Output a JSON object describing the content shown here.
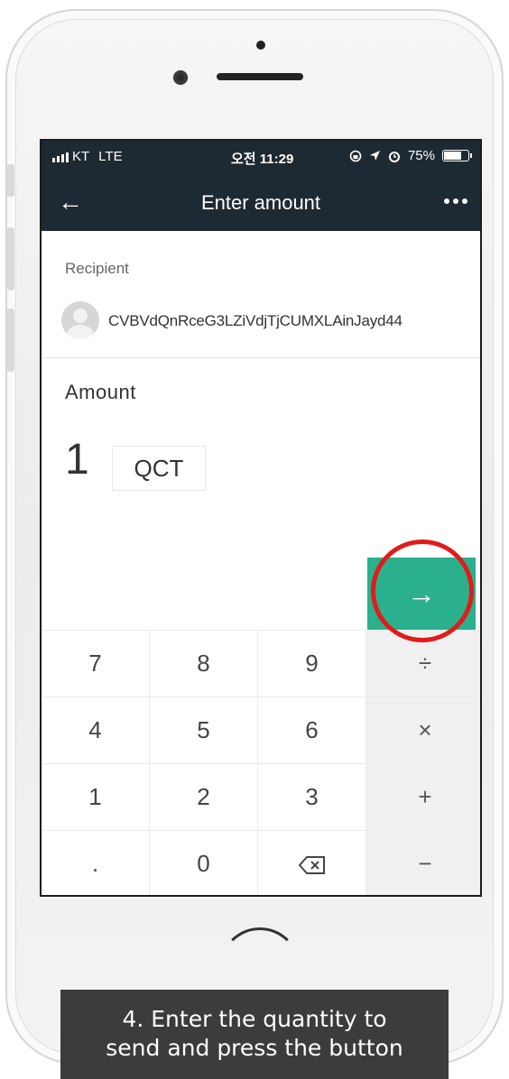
{
  "status_bar": {
    "carrier": "KT",
    "network": "LTE",
    "time": "오전 11:29",
    "status_icons": [
      "rotation-lock-icon",
      "location-icon",
      "alarm-icon"
    ],
    "battery_percent": "75%",
    "battery_level": 0.75
  },
  "app_bar": {
    "back_icon": "arrow-left-icon",
    "title": "Enter amount",
    "more_icon": "more-dots-icon"
  },
  "recipient": {
    "label": "Recipient",
    "address": "CVBVdQnRceG3LZiVdjTjCUMXLAinJayd44"
  },
  "amount": {
    "label": "Amount",
    "value": "1",
    "currency": "QCT"
  },
  "submit": {
    "icon": "arrow-right-icon",
    "symbol": "→",
    "color": "#2bb08d"
  },
  "keypad": {
    "rows": [
      [
        "7",
        "8",
        "9",
        "÷"
      ],
      [
        "4",
        "5",
        "6",
        "×"
      ],
      [
        "1",
        "2",
        "3",
        "+"
      ],
      [
        ".",
        "0",
        "⌫",
        "−"
      ]
    ]
  },
  "caption": {
    "line1": "4. Enter the quantity to",
    "line2": "send and press the button"
  },
  "colors": {
    "header_bg": "#1d2a33",
    "accent": "#2bb08d",
    "highlight": "#e11b1b"
  }
}
